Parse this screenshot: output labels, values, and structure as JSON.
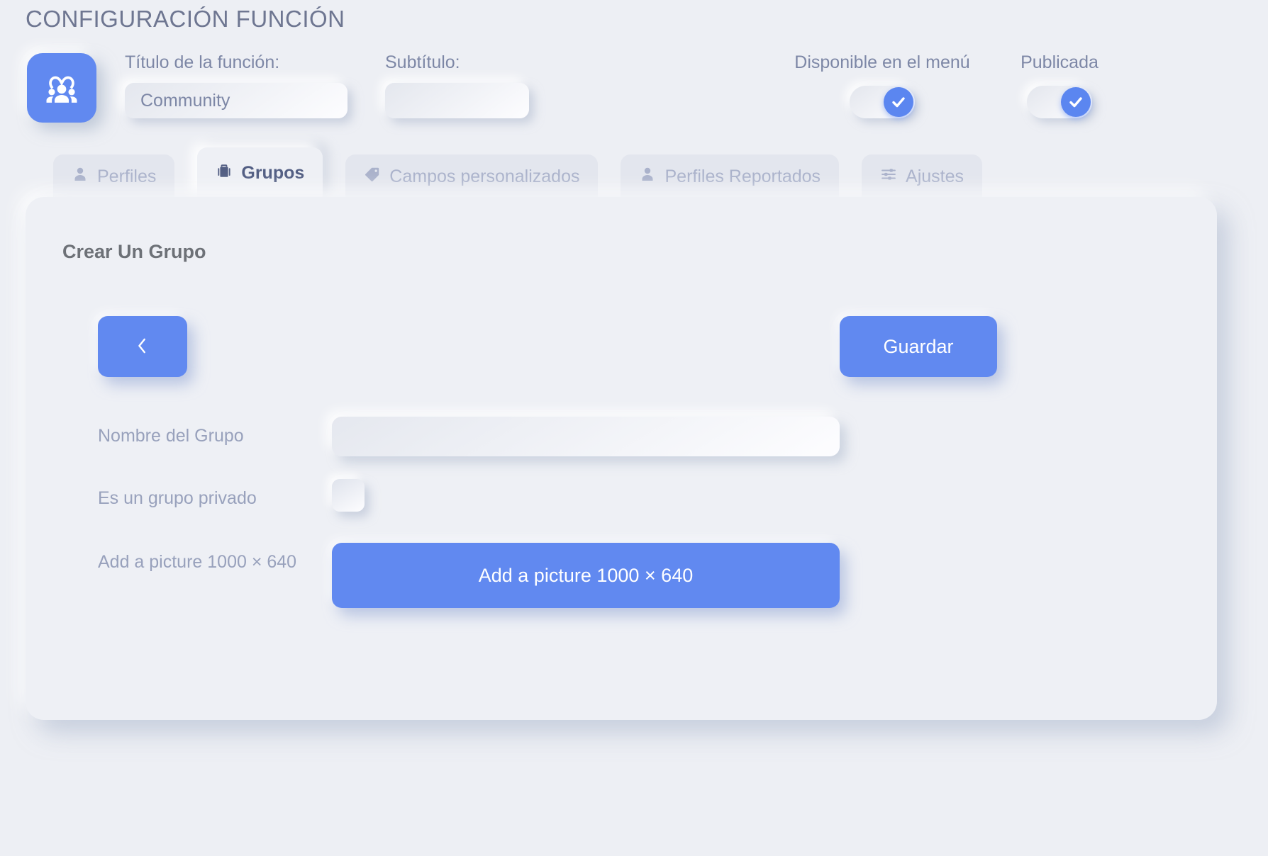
{
  "header": {
    "page_title": "CONFIGURACIÓN FUNCIÓN",
    "app_icon": "community-family-icon",
    "title_label": "Título de la función:",
    "title_value": "Community",
    "title_placeholder": "",
    "subtitle_label": "Subtítulo:",
    "subtitle_value": "",
    "subtitle_placeholder": "",
    "menu_toggle_label": "Disponible en el menú",
    "menu_toggle_state": "on",
    "published_toggle_label": "Publicada",
    "published_toggle_state": "on"
  },
  "tabs": [
    {
      "label": "Perfiles",
      "icon": "person-icon",
      "active": false
    },
    {
      "label": "Grupos",
      "icon": "briefcase-icon",
      "active": true
    },
    {
      "label": "Campos personalizados",
      "icon": "tag-icon",
      "active": false
    },
    {
      "label": "Perfiles Reportados",
      "icon": "person-icon",
      "active": false
    },
    {
      "label": "Ajustes",
      "icon": "sliders-icon",
      "active": false
    }
  ],
  "panel": {
    "heading": "Crear Un Grupo",
    "back_button_icon": "chevron-left-icon",
    "save_button": "Guardar",
    "rows": [
      {
        "label": "Nombre del Grupo",
        "type": "text",
        "value": "",
        "placeholder": ""
      },
      {
        "label": "Es un grupo privado",
        "type": "checkbox",
        "checked": false
      },
      {
        "label": "Add a picture 1000 × 640",
        "type": "button",
        "button_label": "Add a picture 1000 × 640"
      }
    ]
  },
  "colors": {
    "background": "#edeff4",
    "accent_blue": "#6189f0",
    "panel": "#eef0f5",
    "text_muted": "#98a1bc",
    "text_heading": "#6d7177",
    "tab_inactive_text": "#aab2cb",
    "tab_active_text": "#525e83"
  }
}
